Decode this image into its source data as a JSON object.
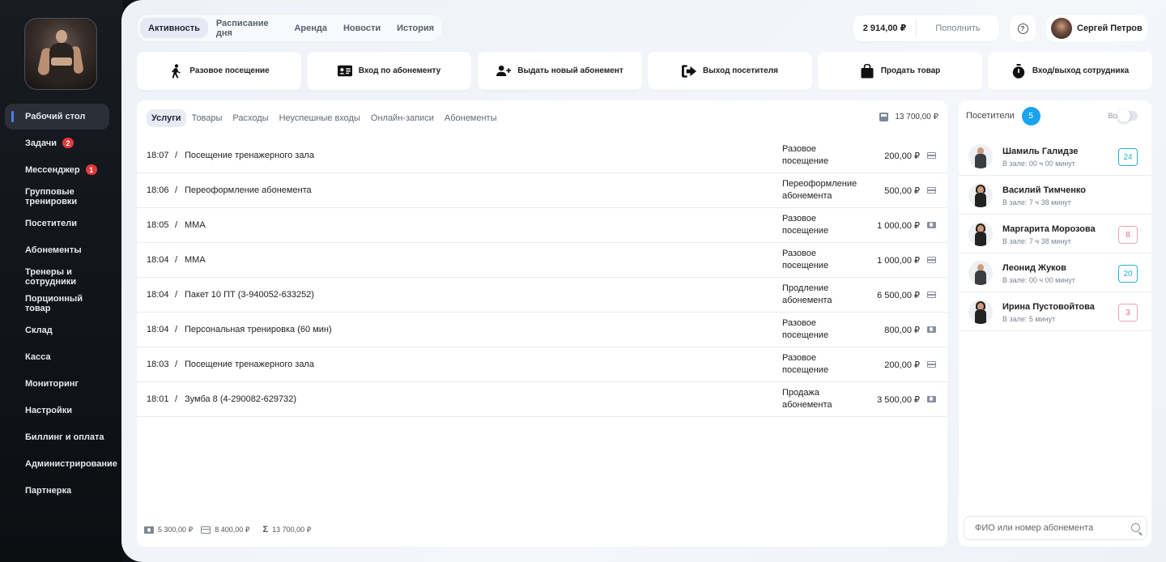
{
  "sidebar": {
    "items": [
      {
        "label": "Рабочий стол",
        "badge": ""
      },
      {
        "label": "Задачи",
        "badge": "2"
      },
      {
        "label": "Мессенджер",
        "badge": "1"
      },
      {
        "label": "Групповые тренировки",
        "badge": ""
      },
      {
        "label": "Посетители",
        "badge": ""
      },
      {
        "label": "Абонементы",
        "badge": ""
      },
      {
        "label": "Тренеры и сотрудники",
        "badge": ""
      },
      {
        "label": "Порционный товар",
        "badge": ""
      },
      {
        "label": "Склад",
        "badge": ""
      },
      {
        "label": "Касса",
        "badge": ""
      },
      {
        "label": "Мониторинг",
        "badge": ""
      },
      {
        "label": "Настройки",
        "badge": ""
      },
      {
        "label": "Биллинг и оплата",
        "badge": ""
      },
      {
        "label": "Администрирование",
        "badge": ""
      },
      {
        "label": "Партнерка",
        "badge": ""
      }
    ]
  },
  "header": {
    "tabs": [
      "Активность",
      "Расписание дня",
      "Аренда",
      "Новости",
      "История"
    ],
    "balance": "2 914,00 ₽",
    "topup": "Пополнить",
    "user_name": "Сергей Петров"
  },
  "actions": [
    {
      "label": "Разовое посещение",
      "icon": "walking-person-icon"
    },
    {
      "label": "Вход по абонементу",
      "icon": "id-card-icon"
    },
    {
      "label": "Выдать новый абонемент",
      "icon": "user-plus-icon"
    },
    {
      "label": "Выход посетителя",
      "icon": "exit-icon"
    },
    {
      "label": "Продать товар",
      "icon": "shopping-bag-icon"
    },
    {
      "label": "Вход/выход сотрудника",
      "icon": "stopwatch-icon"
    }
  ],
  "activity": {
    "tabs": [
      "Услуги",
      "Товары",
      "Расходы",
      "Неуспешные входы",
      "Онлайн-записи",
      "Абонементы"
    ],
    "total": "13 700,00 ₽",
    "rows": [
      {
        "time": "18:07",
        "name": "Посещение тренажерного зала",
        "type": "Разовое посещение",
        "amount": "200,00 ₽",
        "pay": "card"
      },
      {
        "time": "18:06",
        "name": "Переоформление абонемента",
        "type": "Переоформление абонемента",
        "amount": "500,00 ₽",
        "pay": "card"
      },
      {
        "time": "18:05",
        "name": "MMA",
        "type": "Разовое посещение",
        "amount": "1 000,00 ₽",
        "pay": "cash"
      },
      {
        "time": "18:04",
        "name": "MMA",
        "type": "Разовое посещение",
        "amount": "1 000,00 ₽",
        "pay": "card"
      },
      {
        "time": "18:04",
        "name": "Пакет 10 ПТ (3-940052-633252)",
        "type": "Продление абонемента",
        "amount": "6 500,00 ₽",
        "pay": "card"
      },
      {
        "time": "18:04",
        "name": "Персональная тренировка (60 мин)",
        "type": "Разовое посещение",
        "amount": "800,00 ₽",
        "pay": "cash"
      },
      {
        "time": "18:03",
        "name": "Посещение тренажерного зала",
        "type": "Разовое посещение",
        "amount": "200,00 ₽",
        "pay": "card"
      },
      {
        "time": "18:01",
        "name": "Зумба 8 (4-290082-629732)",
        "type": "Продажа абонемента",
        "amount": "3 500,00 ₽",
        "pay": "cash"
      }
    ],
    "footer": {
      "cash": "5 300,00 ₽",
      "card": "8 400,00 ₽",
      "sum": "13 700,00 ₽"
    }
  },
  "visitors": {
    "title": "Посетители",
    "count": "5",
    "all_label": "Все",
    "search_placeholder": "ФИО или номер абонемента",
    "items": [
      {
        "name": "Шамиль Галидзе",
        "time": "В зале: 00 ч 00 минут",
        "badge": "24",
        "badge_color": "blue",
        "gender": "m"
      },
      {
        "name": "Василий Тимченко",
        "time": "В зале: 7 ч 38 минут",
        "badge": "",
        "badge_color": "",
        "gender": "f"
      },
      {
        "name": "Маргарита Морозова",
        "time": "В зале: 7 ч 38 минут",
        "badge": "8",
        "badge_color": "red",
        "gender": "f"
      },
      {
        "name": "Леонид Жуков",
        "time": "В зале: 00 ч 00 минут",
        "badge": "20",
        "badge_color": "blue",
        "gender": "m"
      },
      {
        "name": "Ирина Пустовойтова",
        "time": "В зале: 5 минут",
        "badge": "3",
        "badge_color": "red",
        "gender": "f"
      }
    ]
  }
}
